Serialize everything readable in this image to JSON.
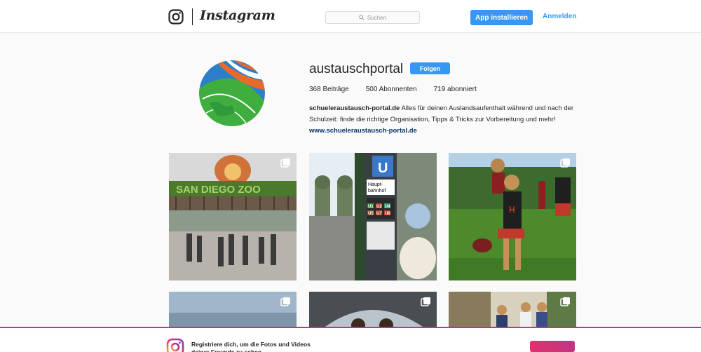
{
  "nav": {
    "brand": "Instagram",
    "search_placeholder": "Suchen",
    "install_label": "App installieren",
    "login_label": "Anmelden"
  },
  "profile": {
    "username": "austauschportal",
    "follow_label": "Folgen",
    "posts": "368 Beiträge",
    "followers": "500 Abonnenten",
    "following": "719 abonniert",
    "bio_name": "schueleraustausch-portal.de",
    "bio_text": " Alles für deinen Auslandsaufenthalt während und nach der Schulzeit: finde die richtige Organisation, Tipps & Tricks zur Vorbereitung und mehr! ",
    "bio_link": "www.schueleraustausch-portal.de"
  },
  "posts": [
    {
      "caption_visible": "SAN DIEGO ZOO"
    },
    {
      "caption_visible": "Hauptbahnhof"
    },
    {
      "caption_visible": ""
    },
    {
      "caption_visible": ""
    },
    {
      "caption_visible": ""
    },
    {
      "caption_visible": ""
    }
  ],
  "banner": {
    "text": "Registriere dich, um die Fotos und Videos deiner Freunde zu sehen"
  },
  "colors": {
    "accent": "#3897f0",
    "banner_border": "#c13584",
    "link": "#003569"
  }
}
